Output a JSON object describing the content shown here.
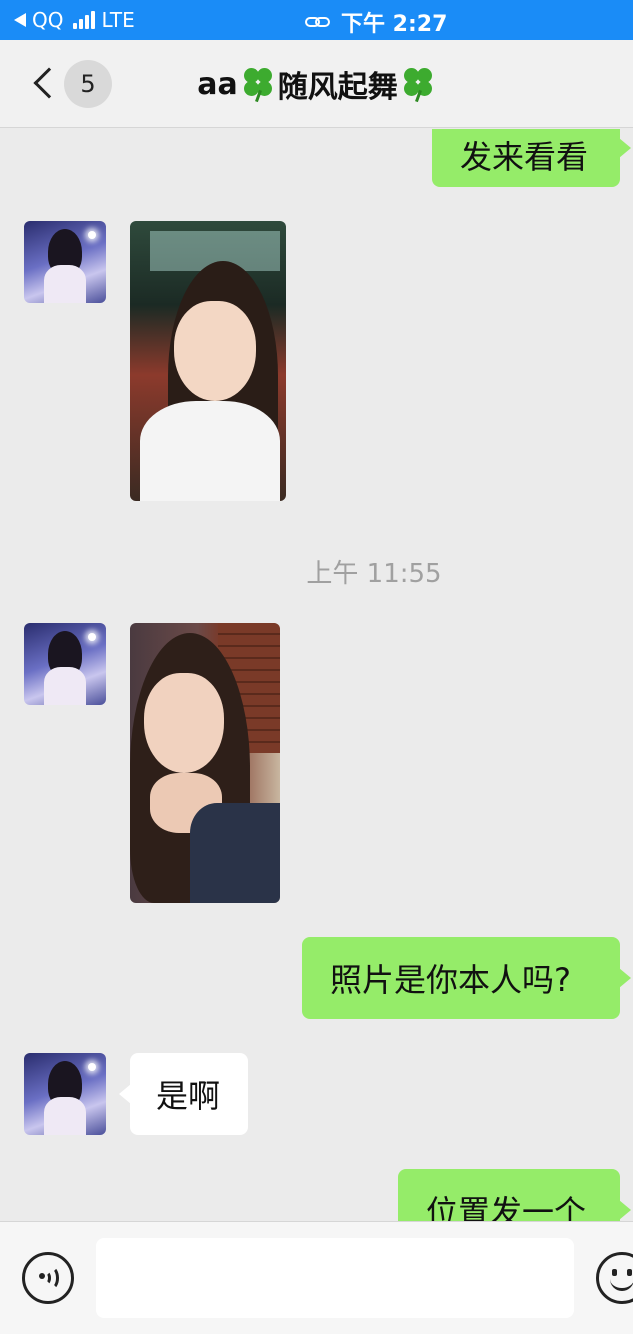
{
  "status_bar": {
    "back_app": "QQ",
    "network": "LTE",
    "time": "下午 2:27",
    "background": "#1a8cf7"
  },
  "header": {
    "back_count": "5",
    "title_prefix": "aa",
    "title_main": "随风起舞",
    "icons": [
      "back-chevron",
      "clover",
      "clover"
    ]
  },
  "messages": [
    {
      "side": "outgoing",
      "type": "text",
      "text": "发来看看"
    },
    {
      "side": "incoming",
      "type": "image",
      "description": "photo"
    },
    {
      "type": "timestamp",
      "text": "上午 11:55"
    },
    {
      "side": "incoming",
      "type": "image",
      "description": "photo"
    },
    {
      "side": "outgoing",
      "type": "text",
      "text": "照片是你本人吗?"
    },
    {
      "side": "incoming",
      "type": "text",
      "text": "是啊"
    },
    {
      "side": "outgoing",
      "type": "text",
      "text": "位置发一个"
    }
  ],
  "input_bar": {
    "value": "",
    "icons": [
      "voice-icon",
      "emoji-icon"
    ]
  },
  "colors": {
    "outgoing_bubble": "#95ec69",
    "incoming_bubble": "#ffffff",
    "chat_background": "#ebebeb"
  }
}
